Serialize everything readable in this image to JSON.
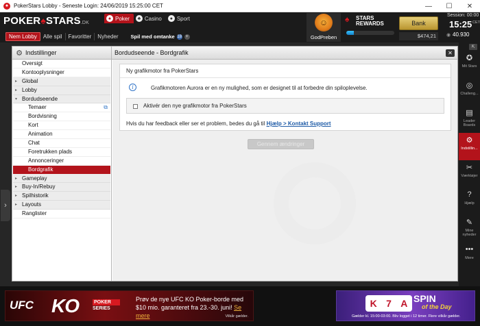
{
  "window": {
    "title": "PokerStars Lobby - Seneste Login: 24/06/2019 15:25:00 CET",
    "minimize": "—",
    "maximize": "☐",
    "close": "✕"
  },
  "header": {
    "logo_text": "POKER",
    "logo_spade": "♠",
    "logo_text2": "STARS",
    "logo_suffix": ".DK",
    "product_tabs": [
      {
        "icon": "♠",
        "label": "Poker",
        "active": true
      },
      {
        "icon": "♣",
        "label": "Casino",
        "active": false
      },
      {
        "icon": "●",
        "label": "Sport",
        "active": false
      }
    ],
    "nav": [
      {
        "label": "Nem Lobby",
        "active": true
      },
      {
        "label": "Alle spil",
        "active": false
      },
      {
        "label": "Favoritter",
        "active": false
      },
      {
        "label": "Nyheder",
        "active": false
      }
    ],
    "promo_link": "Spil med omtanke",
    "promo_badge": "18",
    "promo_plus": "+",
    "avatar_name": "GodPreben",
    "rewards_title_line1": "STARS",
    "rewards_title_line2": "REWARDS",
    "rewards_icon": "♠",
    "rewards_progress": 0.15,
    "bank_label": "Bank",
    "balance": "$474,21",
    "session_label": "Session: 00:00",
    "clock": "15:25",
    "clock_zone": "CET",
    "rank": "40.930",
    "eye_icon": "◉"
  },
  "settings": {
    "sidebar_title": "Indstillinger",
    "content_title": "Bordudseende - Bordgrafik",
    "close_label": "✕",
    "items": [
      {
        "label": "Oversigt",
        "type": "top"
      },
      {
        "label": "Kontooplysninger",
        "type": "top"
      },
      {
        "label": "Global",
        "type": "group",
        "arrow": "▸"
      },
      {
        "label": "Lobby",
        "type": "group",
        "arrow": "▸"
      },
      {
        "label": "Bordudseende",
        "type": "group",
        "arrow": "▾"
      },
      {
        "label": "Temaer",
        "type": "sub",
        "ext": "⧉"
      },
      {
        "label": "Bordvisning",
        "type": "sub"
      },
      {
        "label": "Kort",
        "type": "sub"
      },
      {
        "label": "Animation",
        "type": "sub"
      },
      {
        "label": "Chat",
        "type": "sub"
      },
      {
        "label": "Foretrukken plads",
        "type": "sub"
      },
      {
        "label": "Annonceringer",
        "type": "sub"
      },
      {
        "label": "Bordgrafik",
        "type": "sub",
        "selected": true
      },
      {
        "label": "Gameplay",
        "type": "group",
        "arrow": "▸"
      },
      {
        "label": "Buy-In/Rebuy",
        "type": "group",
        "arrow": "▸"
      },
      {
        "label": "Spilhistorik",
        "type": "group",
        "arrow": "▸"
      },
      {
        "label": "Layouts",
        "type": "group",
        "arrow": "▸"
      },
      {
        "label": "Ranglister",
        "type": "top"
      }
    ],
    "card_title": "Ny grafikmotor fra PokerStars",
    "info_icon": "i",
    "info_text": "Grafikmotoren Aurora er en ny mulighed, som er designet til at forbedre din spiloplevelse.",
    "checkbox_label": "Aktivér den nye grafikmotor fra PokerStars",
    "checkbox_checked": false,
    "feedback_text": "Hvis du har feedback eller ser et problem, bedes du gå til ",
    "feedback_link": "Hjælp > Kontakt Support",
    "save_button": "Gennem ændringer"
  },
  "rail": {
    "pin": "⇱",
    "items": [
      {
        "icon": "✪",
        "label": "Mit Stars",
        "active": false
      },
      {
        "icon": "◎",
        "label": "Challeng...",
        "active": false
      },
      {
        "icon": "▤",
        "label": "Leader Boards",
        "active": false
      },
      {
        "icon": "⚙",
        "label": "Indstillin...",
        "active": true
      },
      {
        "icon": "✂",
        "label": "Værktøjer",
        "active": false
      },
      {
        "icon": "?",
        "label": "Hjælp",
        "active": false
      },
      {
        "icon": "✎",
        "label": "Mine nyheder",
        "active": false
      },
      {
        "icon": "•••",
        "label": "Mere",
        "active": false
      }
    ]
  },
  "banners": {
    "ufc_logo": "UFC",
    "ko": "KO",
    "ko_sub1": "POKER",
    "ko_sub2": "SERIES",
    "ufc_line1": "Prøv de nye UFC KO Poker-borde med",
    "ufc_line2": "$10 mio. garanteret fra 23.-30. juni! ",
    "ufc_link": "Se mere",
    "ufc_terms": "Vilkår gælder.",
    "spin_slots": [
      "K",
      "7",
      "A"
    ],
    "spin_title": "SPIN",
    "spin_sub": "of the Day",
    "spin_note": "Gælder kl. 15:00-03:00. Bliv logget i 12 timer. Flere vilkår gælder."
  },
  "colors": {
    "accent": "#b3131b",
    "header_bg": "#1b1b1b",
    "link": "#1d5aa6",
    "bank_gold": "#d4b455"
  }
}
